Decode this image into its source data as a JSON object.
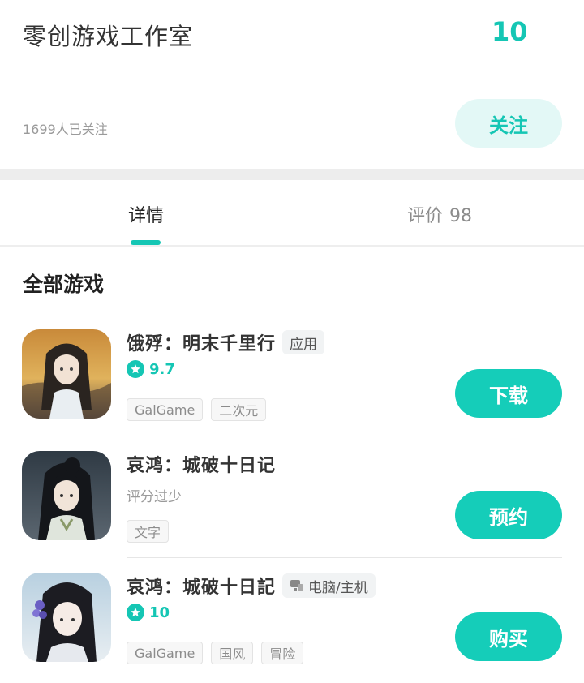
{
  "header": {
    "studio_name": "零创游戏工作室",
    "game_count": "10",
    "followers": "1699人已关注",
    "follow_label": "关注"
  },
  "tabs": [
    {
      "label": "详情",
      "count": ""
    },
    {
      "label": "评价",
      "count": "98"
    }
  ],
  "section_title": "全部游戏",
  "games": [
    {
      "title": "饿殍：明末千里行",
      "badge": "应用",
      "rating": "9.7",
      "tags": [
        "GalGame",
        "二次元"
      ],
      "action": "下载"
    },
    {
      "title": "哀鸿：城破十日记",
      "rating_text": "评分过少",
      "tags": [
        "文字"
      ],
      "action": "预约"
    },
    {
      "title": "哀鸿：城破十日記",
      "badge": "电脑/主机",
      "rating": "10",
      "tags": [
        "GalGame",
        "国风",
        "冒险"
      ],
      "action": "购买"
    }
  ],
  "icons": {
    "star": "star-icon",
    "pc": "pc-console-icon",
    "cover": "game-cover-icon"
  },
  "colors": {
    "accent": "#15c6b4",
    "follow_bg": "#e3f8f6",
    "divider": "#ededed"
  }
}
